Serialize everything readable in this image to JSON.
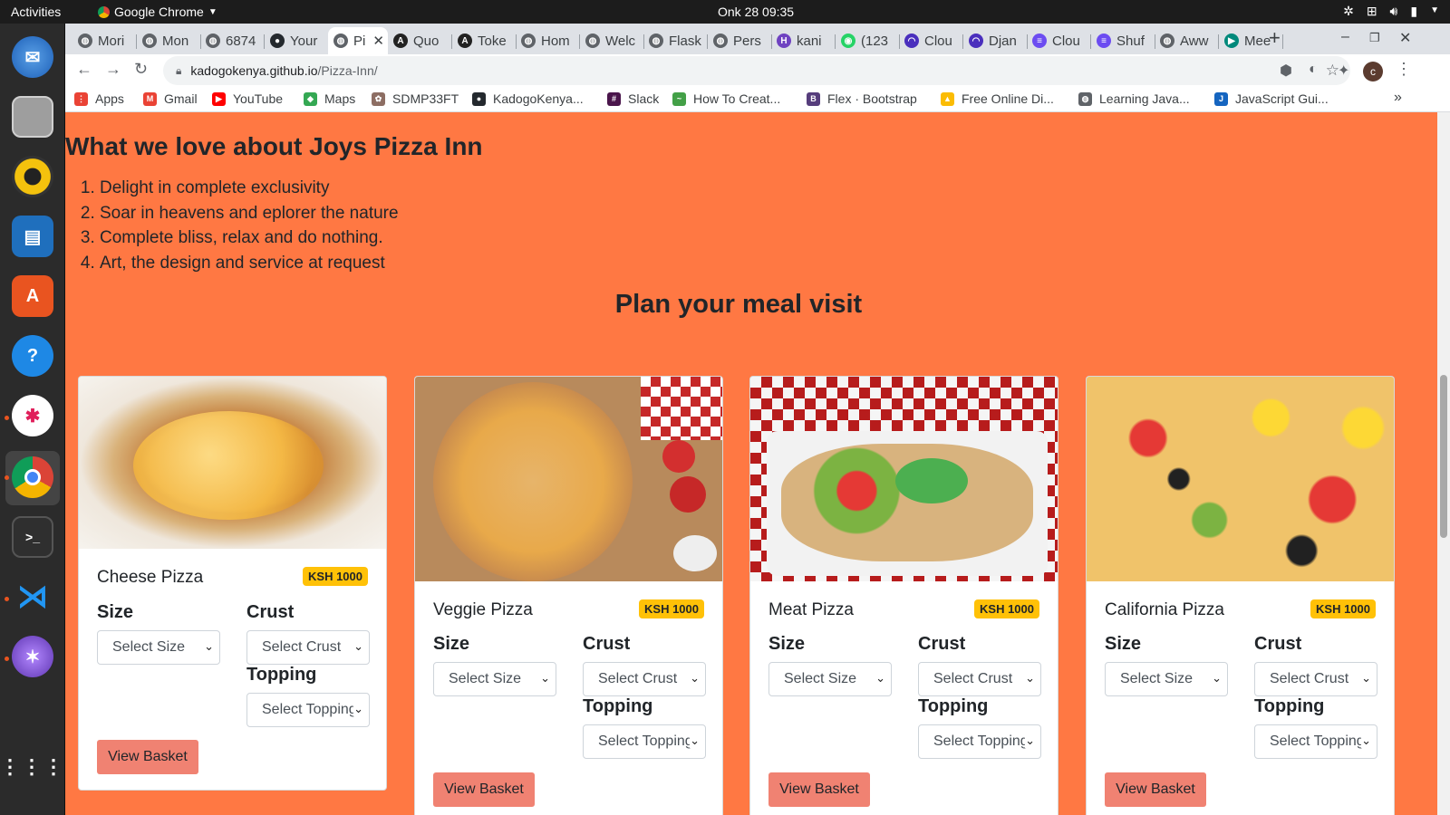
{
  "system": {
    "activities": "Activities",
    "app_name": "Google Chrome",
    "clock": "Onk 28  09:35"
  },
  "tabs": [
    {
      "label": "Mori",
      "icon": "globe-icon"
    },
    {
      "label": "Mon",
      "icon": "globe-icon"
    },
    {
      "label": "6874",
      "icon": "globe-icon"
    },
    {
      "label": "Your",
      "icon": "github-icon"
    },
    {
      "label": "Pi",
      "icon": "globe-icon",
      "active": true
    },
    {
      "label": "Quo",
      "icon": "angular-icon"
    },
    {
      "label": "Toke",
      "icon": "angular-icon"
    },
    {
      "label": "Hom",
      "icon": "globe-icon"
    },
    {
      "label": "Welc",
      "icon": "globe-icon"
    },
    {
      "label": "Flask",
      "icon": "globe-icon"
    },
    {
      "label": "Pers",
      "icon": "globe-icon"
    },
    {
      "label": "kani",
      "icon": "heroku-icon"
    },
    {
      "label": "(123",
      "icon": "whatsapp-icon"
    },
    {
      "label": "Clou",
      "icon": "cloud-icon"
    },
    {
      "label": "Djan",
      "icon": "cloud-icon"
    },
    {
      "label": "Clou",
      "icon": "doc-icon"
    },
    {
      "label": "Shuf",
      "icon": "doc-icon"
    },
    {
      "label": "Aww",
      "icon": "globe-icon"
    },
    {
      "label": "Mee",
      "icon": "meet-icon"
    }
  ],
  "browser": {
    "url_host": "kadogokenya.github.io",
    "url_path": "/Pizza-Inn/",
    "profile_initial": "c"
  },
  "bookmarks": [
    {
      "label": "Apps",
      "icon": "apps-grid-icon"
    },
    {
      "label": "Gmail",
      "icon": "gmail-icon"
    },
    {
      "label": "YouTube",
      "icon": "youtube-icon"
    },
    {
      "label": "Maps",
      "icon": "maps-icon"
    },
    {
      "label": "SDMP33FT",
      "icon": "sdmp-icon"
    },
    {
      "label": "KadogoKenya...",
      "icon": "github-icon"
    },
    {
      "label": "Slack",
      "icon": "slack-icon"
    },
    {
      "label": "How To Creat...",
      "icon": "chart-icon"
    },
    {
      "label": "Flex · Bootstrap",
      "icon": "bootstrap-icon"
    },
    {
      "label": "Free Online Di...",
      "icon": "drive-icon"
    },
    {
      "label": "Learning Java...",
      "icon": "globe-icon"
    },
    {
      "label": "JavaScript Gui...",
      "icon": "js-guide-icon"
    }
  ],
  "page": {
    "love_title": "What we love about Joys Pizza Inn",
    "love_items": [
      "Delight in complete exclusivity",
      "Soar in heavens and eplorer the nature",
      "Complete bliss, relax and do nothing.",
      "Art, the design and service at request"
    ],
    "plan_title": "Plan your meal visit",
    "pizzas": [
      {
        "name": "Cheese Pizza",
        "price": "KSH 1000",
        "size_label": "Size",
        "crust_label": "Crust",
        "topping_label": "Topping",
        "size_select": "Select Size",
        "crust_select": "Select Crust",
        "topping_select": "Select Topping",
        "button": "View Basket"
      },
      {
        "name": "Veggie Pizza",
        "price": "KSH 1000",
        "size_label": "Size",
        "crust_label": "Crust",
        "topping_label": "Topping",
        "size_select": "Select Size",
        "crust_select": "Select Crust",
        "topping_select": "Select Topping",
        "button": "View Basket"
      },
      {
        "name": "Meat Pizza",
        "price": "KSH 1000",
        "size_label": "Size",
        "crust_label": "Crust",
        "topping_label": "Topping",
        "size_select": "Select Size",
        "crust_select": "Select Crust",
        "topping_select": "Select Topping",
        "button": "View Basket"
      },
      {
        "name": "California Pizza",
        "price": "KSH 1000",
        "size_label": "Size",
        "crust_label": "Crust",
        "topping_label": "Topping",
        "size_select": "Select Size",
        "crust_select": "Select Crust",
        "topping_select": "Select Topping",
        "button": "View Basket"
      }
    ]
  },
  "colors": {
    "page_background": "#ff7843",
    "price_badge": "#ffc107",
    "basket_button": "#f08272"
  }
}
